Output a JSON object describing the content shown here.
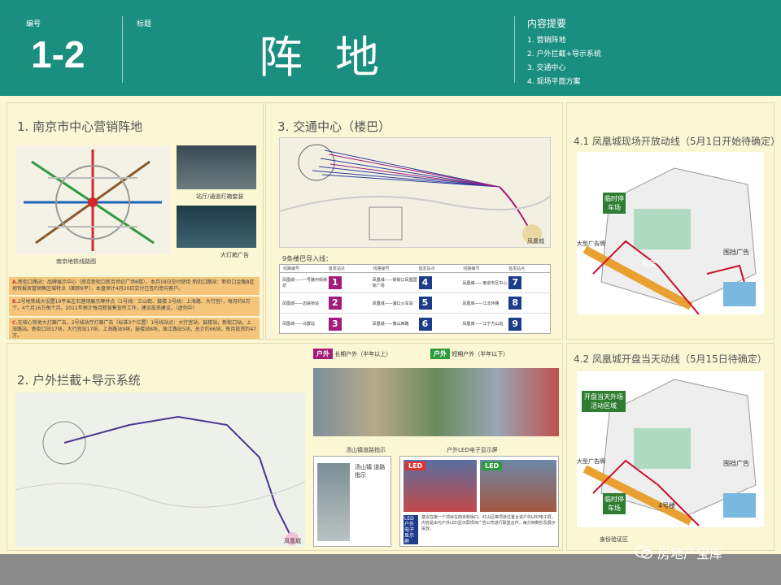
{
  "header": {
    "code_label": "编号",
    "code": "1-2",
    "title_label": "标题",
    "title": "阵地",
    "toc_title": "内容提要",
    "toc": [
      "1. 营销阵地",
      "2. 户外拦截+导示系统",
      "3. 交通中心",
      "4. 现场平面方案"
    ]
  },
  "panel1": {
    "title": "1. 南京市中心营销阵地",
    "map_caption": "南京地铁线路图",
    "photo1_caption": "站厅/通道灯箱套装",
    "photo2_caption": "大灯箱广告",
    "note_a_tag": "A.",
    "note_a": "新街口路站：品牌展示中心（南京新街口新百世纪广场8楼），本月18日交付使用 新街口路站：新街口金融B区地铁报官管销售区域特点（面积9平），本盘预计4月20日交付已签约意向客户。",
    "note_b_tag": "B.",
    "note_b": "2号地铁线大设置19平米左右营销展示牌并点（1号线：三山街、鼓楼 2号线：上海路、大行宫），每月约6万个，4个月16万每个月。2011年预计每月新营售宣传工作，建议投资建议。（虚列中）",
    "note_c_tag": "C.",
    "note_c": "在核心铁地大灯箱广告，2号线站厅灯箱广告（标准3个位置）1号线站点：大行宫站，鼓楼站，新街口站，上海路站。新街口站17块，大行宫站17块，上海路站9块，鼓楼站8块，珠江路站5块，总计约66块。每月投资约47万。"
  },
  "panel3": {
    "title": "3. 交通中心（楼巴）",
    "sub": "9条楼巴导入线：",
    "col_headers": [
      "线路编号",
      "首发站点",
      "线路编号",
      "首发站点",
      "线路编号",
      "首发站点"
    ],
    "rows": [
      [
        "1",
        "凤凰城——一号路中街南坊",
        "4",
        "凤凰城——新街口凤凰国际广场",
        "7",
        "凤凰城——南京市区中心"
      ],
      [
        "2",
        "凤凰城——迈皋桥站",
        "5",
        "凤凰城——浦口火车站",
        "8",
        "凤凰城——江北环路"
      ],
      [
        "3",
        "凤凰城——马群站",
        "6",
        "凤凰城——泰山西路",
        "9",
        "凤凰城——江宁方山站"
      ]
    ],
    "map_label": "凤凰城"
  },
  "panel2": {
    "title": "2. 户外拦截+导示系统",
    "map_label": "凤凰城",
    "legend_long_tag": "户外",
    "legend_long": "长期户外（半年以上）",
    "legend_short_tag": "户外",
    "legend_short": "短期户外（半年以下）",
    "guide_title": "汤山镇道路指示",
    "guide_sign": "汤山镇 道路指示",
    "led_title": "户外LED电子显示屏",
    "led_tag1": "LED",
    "led_tag2": "LED",
    "led_vertical": "LED户外电子显示屏",
    "led_note": "建议在第一个项目在南京新街口、红山区等项目位置合资户外LED电子屏。内容是由与户外LED显示屏项目广告公司进行联盟合作，每分钟数秒及展示投放。"
  },
  "panel41": {
    "title": "4.1 凤凰城现场开放动线（5月1日开始待确定）",
    "parking": "临时停车场",
    "billboard_big": "大型广告牌",
    "billboard": "围挡广告",
    "building": "展室"
  },
  "panel42": {
    "title": "4.2 凤凰城开盘当天动线（5月15日待确定）",
    "activity": "开盘当天外场活动区域",
    "parking": "临时停车场",
    "billboard_big": "大型广告牌",
    "billboard": "围挡广告",
    "building4": "4号楼",
    "check": "身份验证区"
  },
  "watermark": "房地产宝库",
  "colors": {
    "teal": "#1a8f80",
    "cream": "#fbf6d3",
    "magenta": "#a31c7a",
    "navy": "#1e3c8c",
    "orange": "#f4c57b",
    "red": "#c8102e"
  }
}
